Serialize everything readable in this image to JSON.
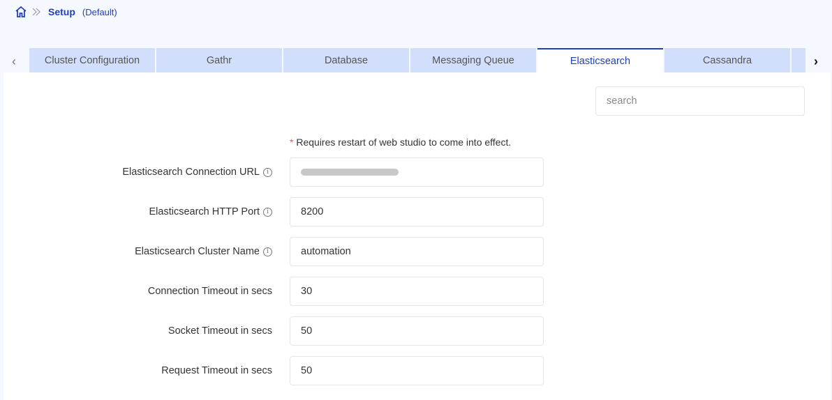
{
  "breadcrumb": {
    "title": "Setup",
    "subtitle": "(Default)"
  },
  "tabs": [
    "Cluster Configuration",
    "Gathr",
    "Database",
    "Messaging Queue",
    "Elasticsearch",
    "Cassandra"
  ],
  "active_tab": "Elasticsearch",
  "search": {
    "placeholder": "search"
  },
  "note": {
    "star": "*",
    "text": "Requires restart of web studio to come into effect."
  },
  "fields": [
    {
      "label": "Elasticsearch Connection URL",
      "value": ""
    },
    {
      "label": "Elasticsearch HTTP Port",
      "value": "8200"
    },
    {
      "label": "Elasticsearch Cluster Name",
      "value": "automation"
    },
    {
      "label": "Connection Timeout in secs",
      "value": "30"
    },
    {
      "label": "Socket Timeout in secs",
      "value": "50"
    },
    {
      "label": "Request Timeout in secs",
      "value": "50"
    }
  ],
  "colors": {
    "accent": "#1f3fbf",
    "tab_bg": "#d1dffd",
    "page_bg": "#f5f8fe"
  }
}
